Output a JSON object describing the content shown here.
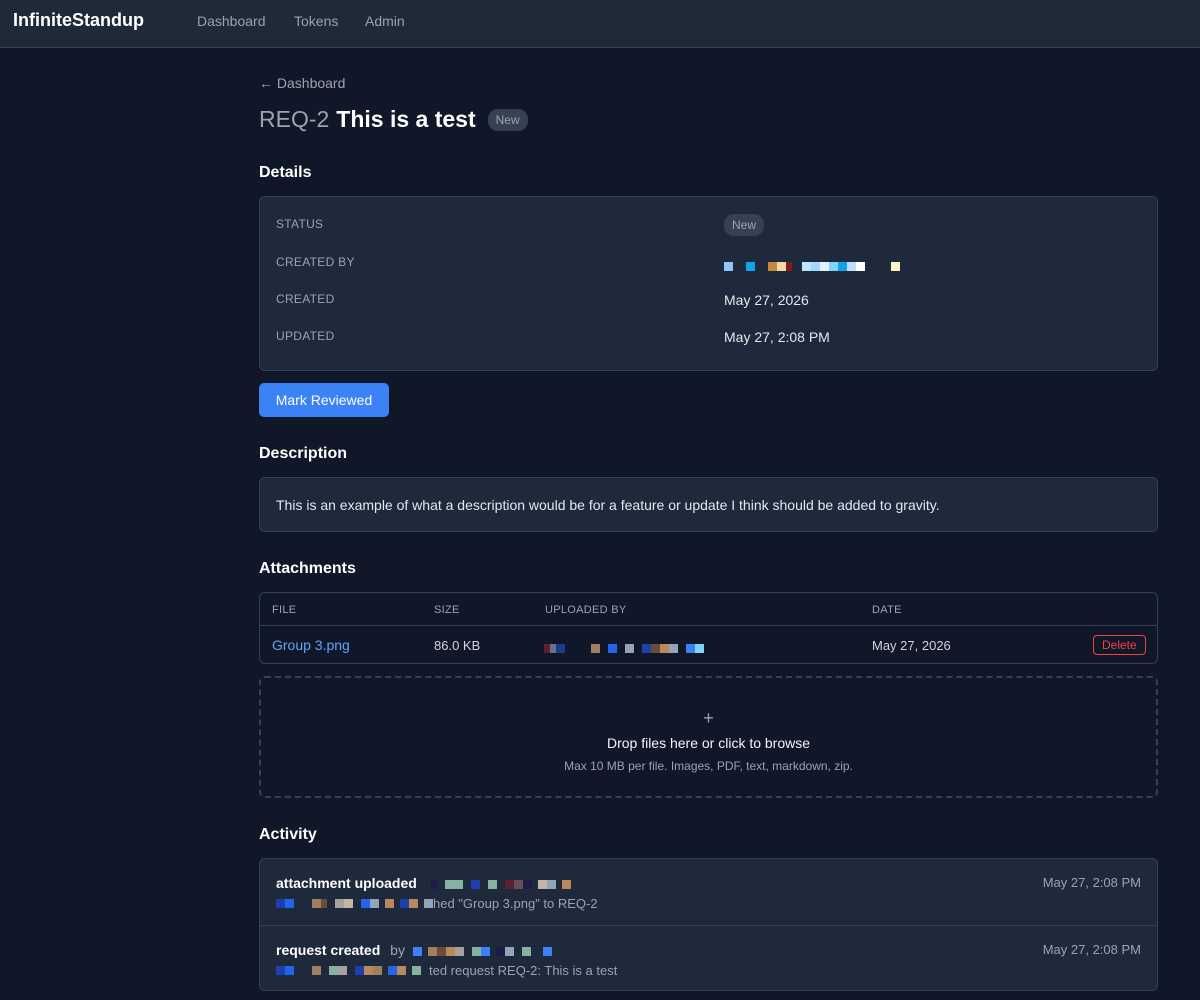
{
  "app": {
    "brand": "InfiniteStandup",
    "nav": [
      "Dashboard",
      "Tokens",
      "Admin"
    ]
  },
  "request": {
    "back_label": "← Dashboard",
    "id": "REQ-2",
    "title": "This is a test",
    "status_badge": "New"
  },
  "details": {
    "heading": "Details",
    "labels": {
      "status": "STATUS",
      "created_by": "CREATED BY",
      "created": "CREATED",
      "updated": "UPDATED"
    },
    "status_value": "New",
    "created_value": "May 27, 2026",
    "updated_value": "May 27, 2:08 PM"
  },
  "actions": {
    "mark_reviewed": "Mark Reviewed"
  },
  "description": {
    "heading": "Description",
    "text": "This is an example of what a description would be for a feature or update I think should be added to gravity."
  },
  "attachments": {
    "heading": "Attachments",
    "columns": [
      "FILE",
      "SIZE",
      "UPLOADED BY",
      "DATE"
    ],
    "rows": [
      {
        "file": "Group 3.png",
        "size": "86.0 KB",
        "date": "May 27, 2026",
        "delete_label": "Delete"
      }
    ],
    "dropzone": {
      "icon": "+",
      "main": "Drop files here or click to browse",
      "sub": "Max 10 MB per file. Images, PDF, text, markdown, zip."
    }
  },
  "activity": {
    "heading": "Activity",
    "items": [
      {
        "type": "attachment uploaded",
        "by": "",
        "detail_suffix": "hed \"Group 3.png\" to REQ-2",
        "time": "May 27, 2:08 PM"
      },
      {
        "type": "request created",
        "by": "by",
        "detail_suffix": "ted request REQ-2: This is a test",
        "time": "May 27, 2:08 PM"
      }
    ]
  },
  "colors": {
    "background": "#0f1729",
    "card": "#1e293b",
    "accent": "#3b82f6",
    "danger": "#ef4444"
  }
}
